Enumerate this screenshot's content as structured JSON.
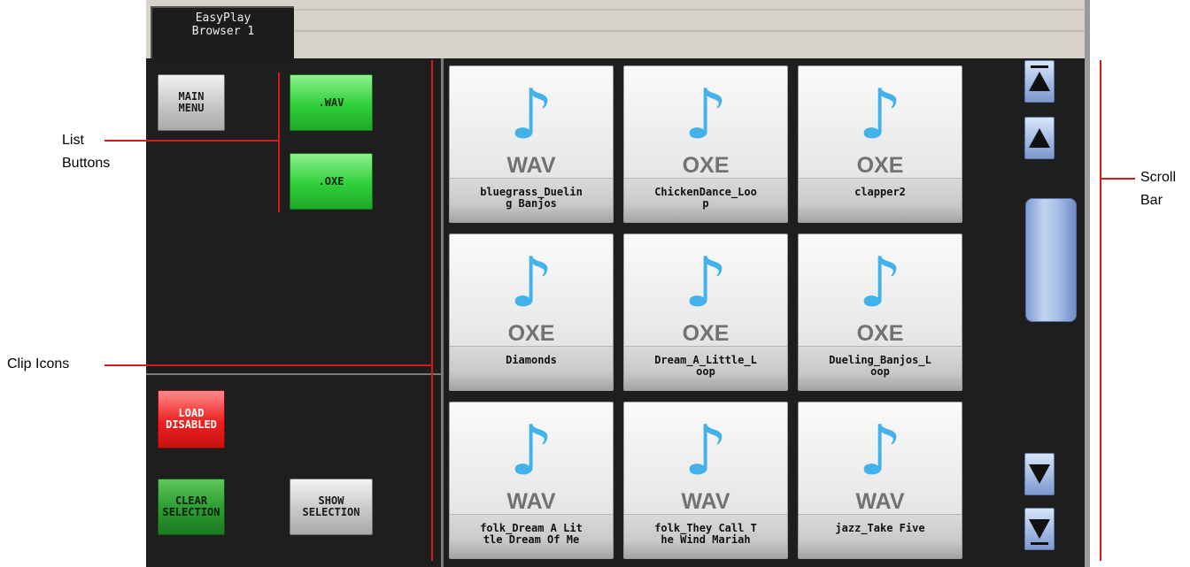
{
  "window": {
    "tab_label": "EasyPlay\nBrowser 1"
  },
  "left_panel": {
    "main_menu_label": "MAIN\nMENU",
    "list_buttons": [
      ".WAV",
      ".OXE"
    ],
    "load_label": "LOAD\nDISABLED",
    "clear_label": "CLEAR\nSELECTION",
    "show_label": "SHOW\nSELECTION"
  },
  "clips": [
    {
      "ext": "WAV",
      "name": "bluegrass_Duelin\ng Banjos"
    },
    {
      "ext": "OXE",
      "name": "ChickenDance_Loo\np"
    },
    {
      "ext": "OXE",
      "name": "clapper2"
    },
    {
      "ext": "OXE",
      "name": "Diamonds"
    },
    {
      "ext": "OXE",
      "name": "Dream_A_Little_L\noop"
    },
    {
      "ext": "OXE",
      "name": "Dueling_Banjos_L\noop"
    },
    {
      "ext": "WAV",
      "name": "folk_Dream A Lit\ntle Dream Of Me"
    },
    {
      "ext": "WAV",
      "name": "folk_They Call T\nhe Wind Mariah"
    },
    {
      "ext": "WAV",
      "name": "jazz_Take Five"
    }
  ],
  "clip_icon": "music-note-icon",
  "callouts": {
    "list_buttons": "List\nButtons",
    "clip_icons": "Clip Icons",
    "scroll_bar": "Scroll\nBar"
  },
  "colors": {
    "panel_bg": "#1e1e1e",
    "list_button_green": "#2fcf3a",
    "load_red": "#ee2020",
    "note_blue": "#44b2ea",
    "scroll_blue": "#a8bfe6",
    "annotation_red": "#d31b1b"
  }
}
